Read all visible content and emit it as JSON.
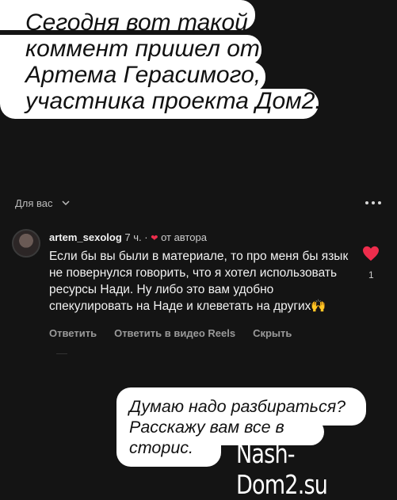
{
  "caption_top": "Сегодня вот такой\nкоммент пришел от\nАртема Герасимого,\nучастника проекта Дом2.",
  "header": {
    "for_you": "Для вас"
  },
  "comment": {
    "username": "artem_sexolog",
    "time": "7 ч.",
    "separator": "·",
    "liked_by": "от автора",
    "text": "Если бы вы были в материале, то про меня бы язык не повернулся говорить, что я хотел использовать ресурсы Нади. Ну либо это вам удобно спекулировать на Наде и клеветать на других🙌",
    "like_count": "1",
    "actions": {
      "reply": "Ответить",
      "reply_reels": "Ответить в видео Reels",
      "hide": "Скрыть"
    }
  },
  "caption_bottom": "Думаю надо разбираться?\nРасскажу вам все в\nсторис.",
  "watermark": "Nash-Dom2.su",
  "colors": {
    "like": "#ee2d4c",
    "background": "#141414"
  },
  "icons": [
    "chevron-down-icon",
    "more-icon",
    "heart-icon"
  ]
}
